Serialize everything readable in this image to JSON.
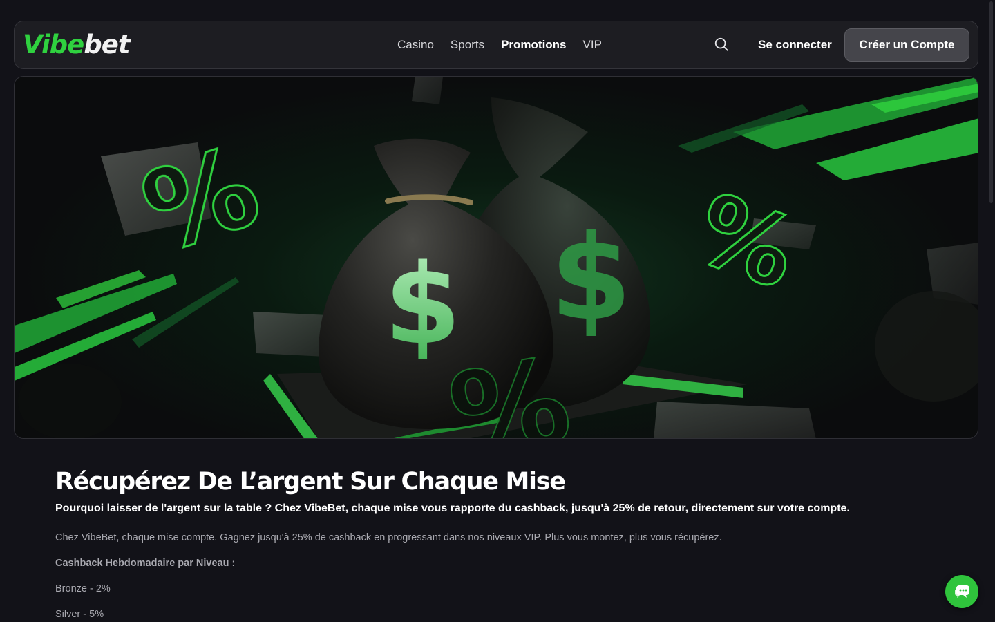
{
  "header": {
    "logo_part1": "Vibe",
    "logo_part2": "bet",
    "nav": [
      {
        "label": "Casino"
      },
      {
        "label": "Sports"
      },
      {
        "label": "Promotions",
        "active": true
      },
      {
        "label": "VIP"
      }
    ],
    "login_label": "Se connecter",
    "signup_label": "Créer un Compte",
    "search_icon": "search-icon"
  },
  "hero": {
    "image_subject": "money-bags-with-percent-symbols-banner",
    "bag_glyph": "$",
    "percent_glyph": "%"
  },
  "content": {
    "title": "Récupérez De L’argent Sur Chaque Mise",
    "subtitle": "Pourquoi laisser de l'argent sur la table ? Chez VibeBet, chaque mise vous rapporte du cashback, jusqu'à 25% de retour, directement sur votre compte.",
    "paragraph": "Chez VibeBet, chaque mise compte. Gagnez jusqu'à 25% de cashback en progressant dans nos niveaux VIP. Plus vous montez, plus vous récupérez.",
    "list_heading": "Cashback Hebdomadaire par Niveau :",
    "tiers": [
      {
        "label": "Bronze - 2%"
      },
      {
        "label": "Silver - 5%"
      }
    ]
  },
  "chat": {
    "icon": "chat-bubbles-icon"
  },
  "colors": {
    "accent": "#2fd13f",
    "background": "#121218",
    "header_bg": "#1d1d22",
    "button_bg": "#45454b",
    "chat_bg": "#2fc43c"
  }
}
